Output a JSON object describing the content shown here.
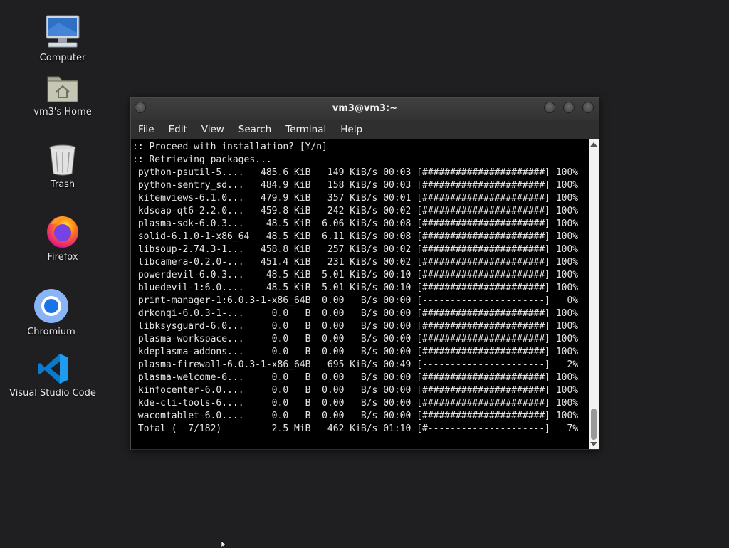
{
  "desktop": {
    "icons": [
      {
        "label": "Computer",
        "icon": "computer-icon"
      },
      {
        "label": "vm3's Home",
        "icon": "home-folder-icon"
      },
      {
        "label": "Trash",
        "icon": "trash-icon"
      },
      {
        "label": "Firefox",
        "icon": "firefox-icon"
      },
      {
        "label": "Chromium",
        "icon": "chromium-icon"
      },
      {
        "label": "Visual Studio Code",
        "icon": "vscode-icon"
      }
    ]
  },
  "window": {
    "title": "vm3@vm3:~",
    "menu": [
      "File",
      "Edit",
      "View",
      "Search",
      "Terminal",
      "Help"
    ]
  },
  "terminal": {
    "lines": [
      ":: Proceed with installation? [Y/n]",
      ":: Retrieving packages...",
      " python-psutil-5....   485.6 KiB   149 KiB/s 00:03 [######################] 100%",
      " python-sentry_sd...   484.9 KiB   158 KiB/s 00:03 [######################] 100%",
      " kitemviews-6.1.0...   479.9 KiB   357 KiB/s 00:01 [######################] 100%",
      " kdsoap-qt6-2.2.0...   459.8 KiB   242 KiB/s 00:02 [######################] 100%",
      " plasma-sdk-6.0.3...    48.5 KiB  6.06 KiB/s 00:08 [######################] 100%",
      " solid-6.1.0-1-x86_64   48.5 KiB  6.11 KiB/s 00:08 [######################] 100%",
      " libsoup-2.74.3-1...   458.8 KiB   257 KiB/s 00:02 [######################] 100%",
      " libcamera-0.2.0-...   451.4 KiB   231 KiB/s 00:02 [######################] 100%",
      " powerdevil-6.0.3...    48.5 KiB  5.01 KiB/s 00:10 [######################] 100%",
      " bluedevil-1:6.0....    48.5 KiB  5.01 KiB/s 00:10 [######################] 100%",
      " print-manager-1:6.0.3-1-x86_64B  0.00   B/s 00:00 [----------------------]   0%",
      " drkonqi-6.0.3-1-...     0.0   B  0.00   B/s 00:00 [######################] 100%",
      " libksysguard-6.0...     0.0   B  0.00   B/s 00:00 [######################] 100%",
      " plasma-workspace...     0.0   B  0.00   B/s 00:00 [######################] 100%",
      " kdeplasma-addons...     0.0   B  0.00   B/s 00:00 [######################] 100%",
      " plasma-firewall-6.0.3-1-x86_64B   695 KiB/s 00:49 [----------------------]   2%",
      " plasma-welcome-6...     0.0   B  0.00   B/s 00:00 [######################] 100%",
      " kinfocenter-6.0....     0.0   B  0.00   B/s 00:00 [######################] 100%",
      " kde-cli-tools-6....     0.0   B  0.00   B/s 00:00 [######################] 100%",
      " wacomtablet-6.0....     0.0   B  0.00   B/s 00:00 [######################] 100%",
      " Total (  7/182)         2.5 MiB   462 KiB/s 01:10 [#---------------------]   7%"
    ]
  }
}
